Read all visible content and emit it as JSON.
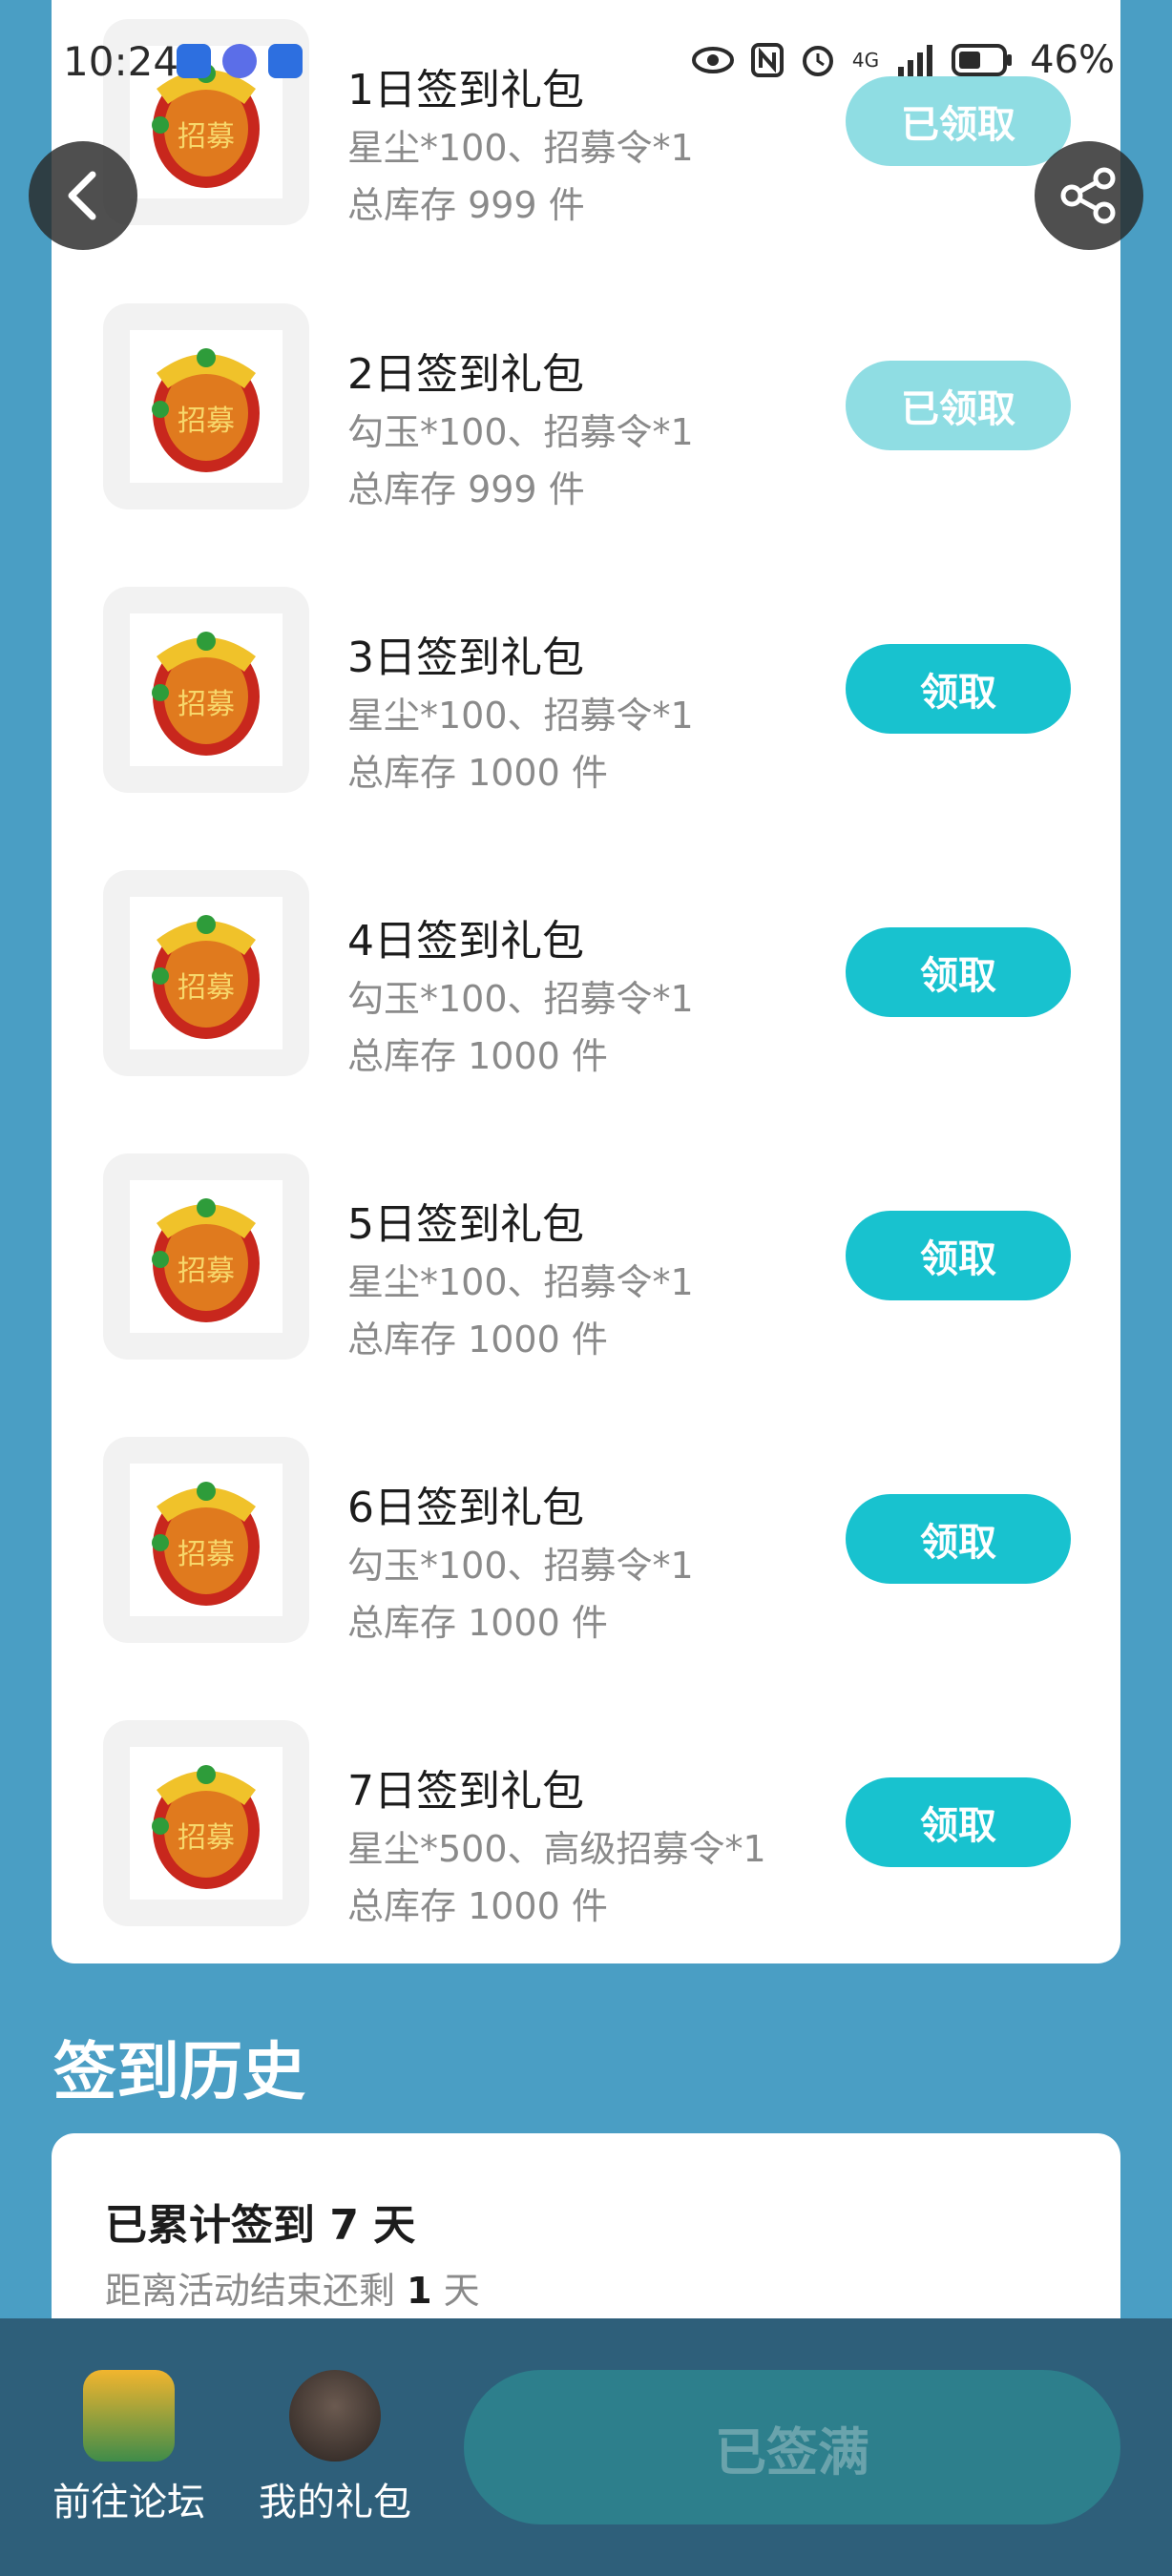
{
  "status_bar": {
    "time": "10:24",
    "battery": "46%",
    "network": "4G"
  },
  "gifts": [
    {
      "title": "1日签到礼包",
      "desc": "星尘*100、招募令*1",
      "stock": "总库存 999 件",
      "button": "已领取",
      "claimed": true
    },
    {
      "title": "2日签到礼包",
      "desc": "勾玉*100、招募令*1",
      "stock": "总库存 999 件",
      "button": "已领取",
      "claimed": true
    },
    {
      "title": "3日签到礼包",
      "desc": "星尘*100、招募令*1",
      "stock": "总库存 1000 件",
      "button": "领取",
      "claimed": false
    },
    {
      "title": "4日签到礼包",
      "desc": "勾玉*100、招募令*1",
      "stock": "总库存 1000 件",
      "button": "领取",
      "claimed": false
    },
    {
      "title": "5日签到礼包",
      "desc": "星尘*100、招募令*1",
      "stock": "总库存 1000 件",
      "button": "领取",
      "claimed": false
    },
    {
      "title": "6日签到礼包",
      "desc": "勾玉*100、招募令*1",
      "stock": "总库存 1000 件",
      "button": "领取",
      "claimed": false
    },
    {
      "title": "7日签到礼包",
      "desc": "星尘*500、高级招募令*1",
      "stock": "总库存 1000 件",
      "button": "领取",
      "claimed": false
    }
  ],
  "gift_icon_text": "招募",
  "history": {
    "title": "签到历史",
    "total_prefix": "已累计签到",
    "total_days": "7",
    "total_suffix": "天",
    "remain_prefix": "距离活动结束还剩",
    "remain_days": "1",
    "remain_suffix": "天"
  },
  "bottom_bar": {
    "forum_label": "前往论坛",
    "gifts_label": "我的礼包",
    "signed_label": "已签满"
  },
  "icons": {
    "back": "back-arrow-icon",
    "share": "share-icon",
    "gift": "recruit-token-icon",
    "forum": "game-avatar-icon",
    "my_gifts": "user-avatar-icon"
  },
  "colors": {
    "background": "#4a9ec4",
    "accent": "#18c2cf",
    "accent_disabled": "#8fdde3",
    "bottom_bar": "#2e5f7a"
  }
}
